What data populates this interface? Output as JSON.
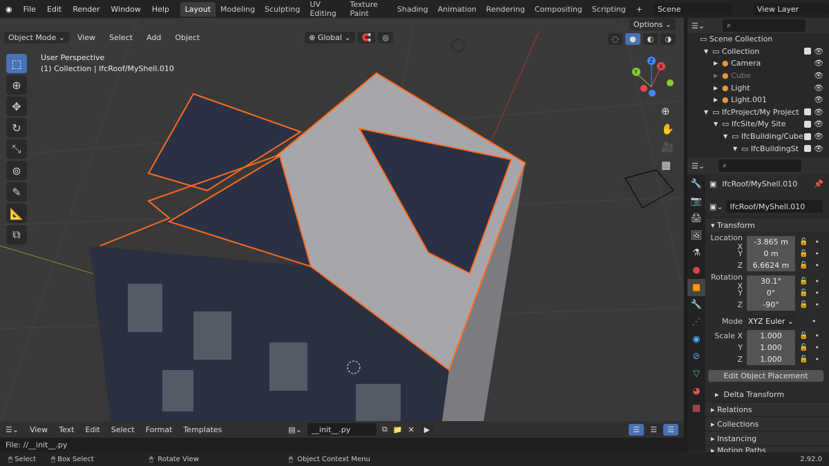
{
  "topbar": {
    "menus": [
      "File",
      "Edit",
      "Render",
      "Window",
      "Help"
    ],
    "workspaces": [
      "Layout",
      "Modeling",
      "Sculpting",
      "UV Editing",
      "Texture Paint",
      "Shading",
      "Animation",
      "Rendering",
      "Compositing",
      "Scripting"
    ],
    "active_workspace": "Layout",
    "scene": "Scene",
    "view_layer": "View Layer"
  },
  "viewport": {
    "mode": "Object Mode",
    "menus": [
      "View",
      "Select",
      "Add",
      "Object"
    ],
    "orientation": "Global",
    "options": "Options",
    "perspective": "User Perspective",
    "active_object": "(1) Collection | IfcRoof/MyShell.010",
    "selection_color": "#ff6a1f",
    "tools": [
      "select-box",
      "cursor",
      "move",
      "rotate",
      "scale",
      "transform",
      "annotate",
      "measure",
      "add-cube"
    ],
    "gizmo": {
      "x": "X",
      "y": "Y",
      "z": "Z"
    }
  },
  "outliner": {
    "root": "Scene Collection",
    "items": [
      {
        "label": "Collection",
        "depth": 1,
        "check": true
      },
      {
        "label": "Camera",
        "depth": 2,
        "check": false
      },
      {
        "label": "Cube",
        "depth": 2,
        "check": false,
        "disabled": true
      },
      {
        "label": "Light",
        "depth": 2,
        "check": false
      },
      {
        "label": "Light.001",
        "depth": 2,
        "check": false
      },
      {
        "label": "IfcProject/My Project",
        "depth": 1,
        "check": true
      },
      {
        "label": "IfcSite/My Site",
        "depth": 2,
        "check": true
      },
      {
        "label": "IfcBuilding/Cube",
        "depth": 3,
        "check": true
      },
      {
        "label": "IfcBuildingSt",
        "depth": 4,
        "check": true
      }
    ]
  },
  "properties": {
    "object_name": "IfcRoof/MyShell.010",
    "name_field": "IfcRoof/MyShell.010",
    "transform": "Transform",
    "location": {
      "label": "Location X",
      "x": "-3.865 m",
      "y": "0 m",
      "z": "6.6624 m"
    },
    "rotation": {
      "label": "Rotation X",
      "x": "30.1°",
      "y": "0°",
      "z": "-90°"
    },
    "mode_label": "Mode",
    "mode": "XYZ Euler",
    "scale": {
      "label": "Scale X",
      "x": "1.000",
      "y": "1.000",
      "z": "1.000"
    },
    "axis_y": "Y",
    "axis_z": "Z",
    "edit_placement": "Edit Object Placement",
    "sections": [
      "Delta Transform",
      "Relations",
      "Collections",
      "Instancing",
      "Motion Paths"
    ]
  },
  "text_editor": {
    "menus": [
      "View",
      "Text",
      "Edit",
      "Select",
      "Format",
      "Templates"
    ],
    "file": "__init__.py",
    "path": "File: //__init__.py"
  },
  "status": {
    "select": "Select",
    "box_select": "Box Select",
    "rotate": "Rotate View",
    "context": "Object Context Menu",
    "version": "2.92.0"
  }
}
